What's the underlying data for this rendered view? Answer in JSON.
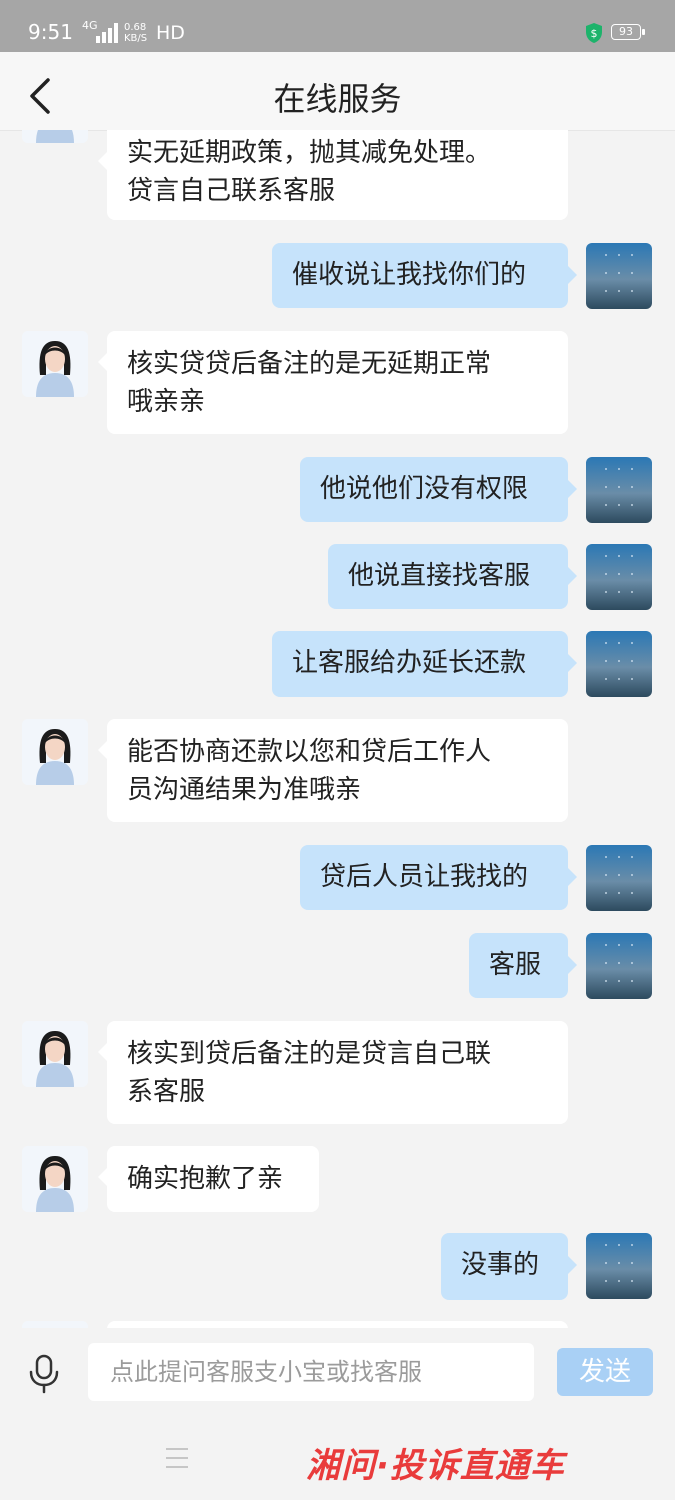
{
  "status_bar": {
    "time": "9:51",
    "network": "4G",
    "speed_value": "0.68",
    "speed_unit": "KB/S",
    "hd": "HD",
    "battery": "93"
  },
  "header": {
    "title": "在线服务"
  },
  "messages": [
    {
      "side": "agent",
      "text": "实无延期政策，抛其减免处理。\n贷言自己联系客服"
    },
    {
      "side": "user",
      "text": "催收说让我找你们的"
    },
    {
      "side": "agent",
      "text": "核实贷贷后备注的是无延期正常\n哦亲亲"
    },
    {
      "side": "user",
      "text": "他说他们没有权限"
    },
    {
      "side": "user",
      "text": "他说直接找客服"
    },
    {
      "side": "user",
      "text": "让客服给办延长还款"
    },
    {
      "side": "agent",
      "text": "能否协商还款以您和贷后工作人\n员沟通结果为准哦亲"
    },
    {
      "side": "user",
      "text": "贷后人员让我找的"
    },
    {
      "side": "user",
      "text": "客服"
    },
    {
      "side": "agent",
      "text": "核实到贷后备注的是贷言自己联\n系客服"
    },
    {
      "side": "agent",
      "text": "确实抱歉了亲"
    },
    {
      "side": "user",
      "text": "没事的"
    }
  ],
  "input_bar": {
    "placeholder": "点此提问客服支小宝或找客服",
    "send_label": "发送"
  },
  "watermark": "湘问·投诉直通车",
  "icons": [
    "back-arrow-icon",
    "mic-icon",
    "menu-icon",
    "shield-icon",
    "signal-icon",
    "battery-icon"
  ],
  "colors": {
    "user_bubble": "#c6e3fb",
    "agent_bubble": "#ffffff",
    "send_button": "#a9d0f5",
    "status_bar": "#a6a6a6"
  }
}
